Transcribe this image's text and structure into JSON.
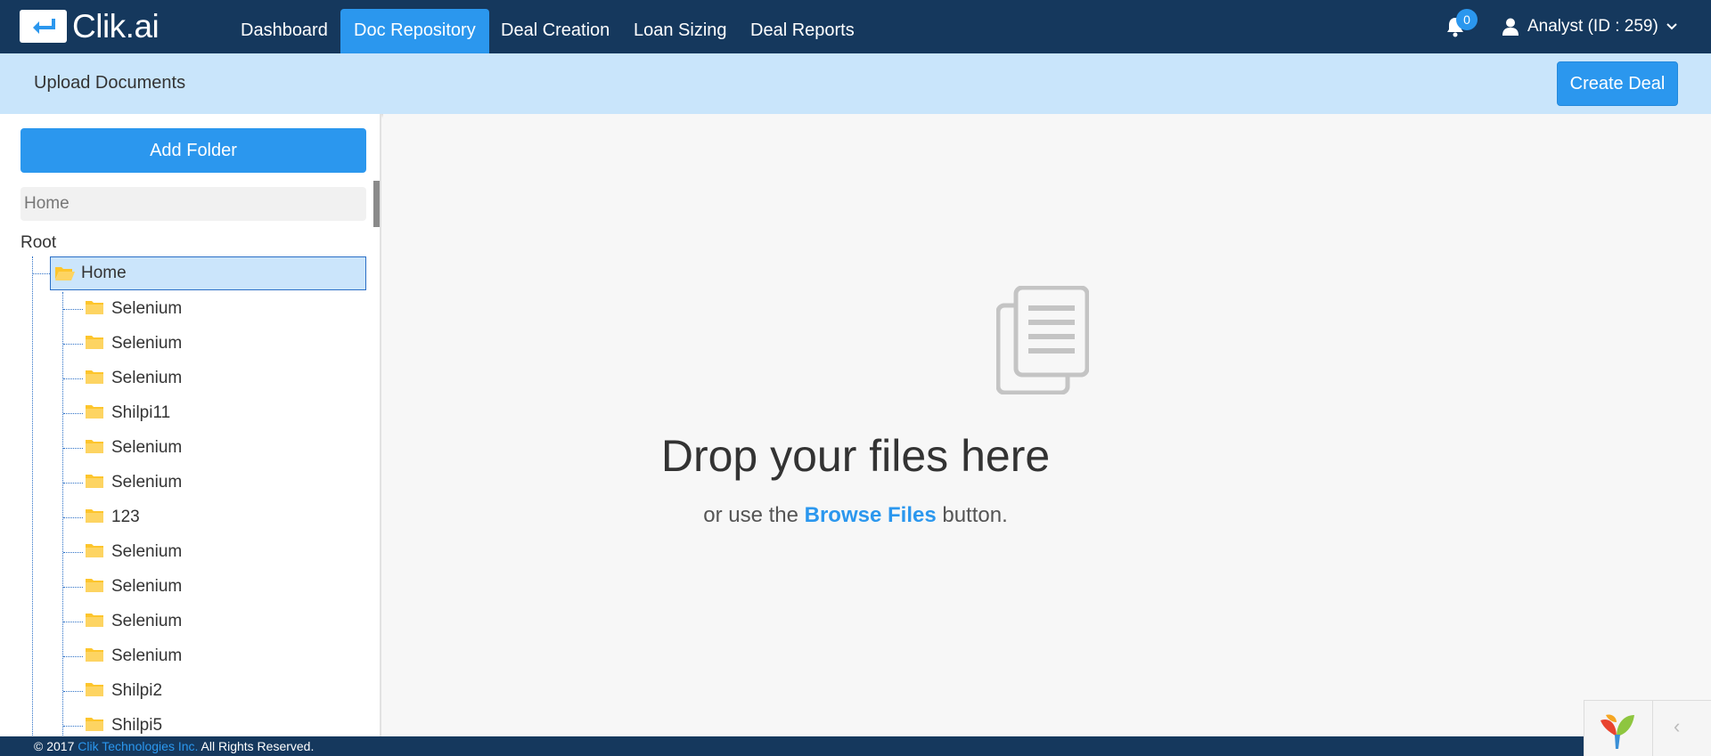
{
  "app": {
    "logo_text": "Clik.ai"
  },
  "nav": {
    "items": [
      {
        "label": "Dashboard",
        "active": false
      },
      {
        "label": "Doc Repository",
        "active": true
      },
      {
        "label": "Deal Creation",
        "active": false
      },
      {
        "label": "Loan Sizing",
        "active": false
      },
      {
        "label": "Deal Reports",
        "active": false
      }
    ],
    "notification_count": "0",
    "user_label": "Analyst (ID : 259)"
  },
  "subheader": {
    "title": "Upload Documents",
    "create_deal_label": "Create Deal"
  },
  "sidebar": {
    "add_folder_label": "Add Folder",
    "current_folder_value": "Home",
    "tree": {
      "root_label": "Root",
      "home_label": "Home",
      "children": [
        "Selenium",
        "Selenium",
        "Selenium",
        "Shilpi11",
        "Selenium",
        "Selenium",
        "123",
        "Selenium",
        "Selenium",
        "Selenium",
        "Selenium",
        "Shilpi2",
        "Shilpi5"
      ]
    }
  },
  "dropzone": {
    "title": "Drop your files here",
    "sub_prefix": "or use the",
    "browse_label": "Browse Files",
    "sub_suffix": "button."
  },
  "footer": {
    "prefix": "© 2017",
    "company": "Clik Technologies Inc.",
    "suffix": "All Rights Reserved."
  },
  "colors": {
    "navbar": "#15385d",
    "accent": "#2b97ee",
    "subheader": "#c9e5fb",
    "folder": "#fdc52c"
  }
}
